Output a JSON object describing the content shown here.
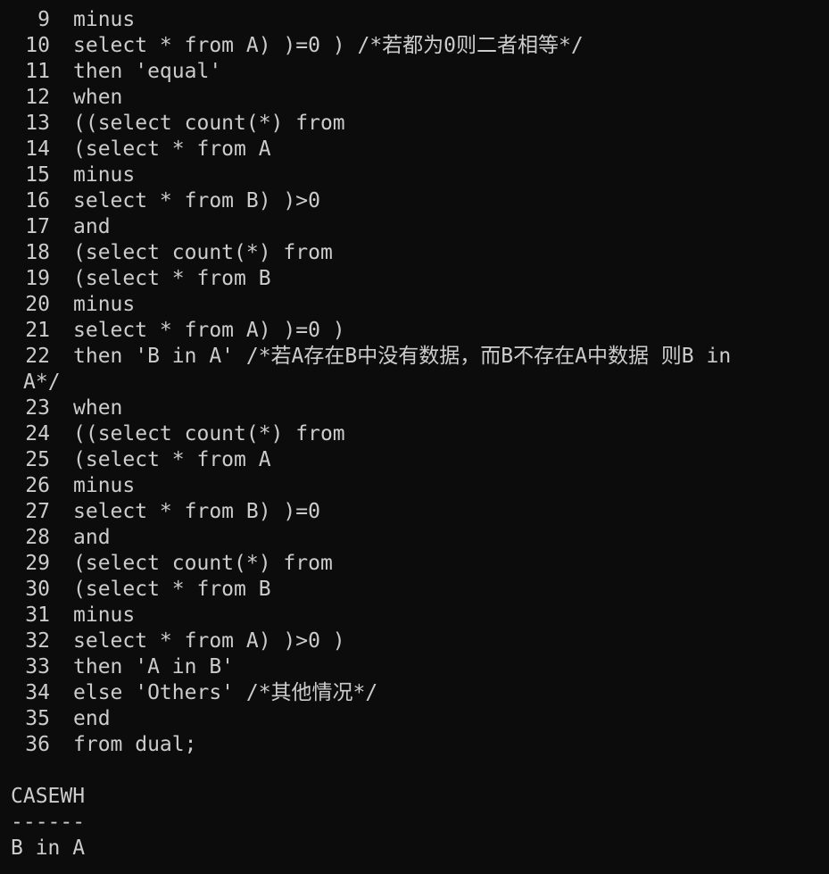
{
  "terminal": {
    "sql_lines": [
      {
        "num": "9",
        "text": "minus"
      },
      {
        "num": "10",
        "text": "select * from A) )=0 ) /*若都为0则二者相等*/"
      },
      {
        "num": "11",
        "text": "then 'equal'"
      },
      {
        "num": "12",
        "text": "when"
      },
      {
        "num": "13",
        "text": "((select count(*) from"
      },
      {
        "num": "14",
        "text": "(select * from A"
      },
      {
        "num": "15",
        "text": "minus"
      },
      {
        "num": "16",
        "text": "select * from B) )>0"
      },
      {
        "num": "17",
        "text": "and"
      },
      {
        "num": "18",
        "text": "(select count(*) from"
      },
      {
        "num": "19",
        "text": "(select * from B"
      },
      {
        "num": "20",
        "text": "minus"
      },
      {
        "num": "21",
        "text": "select * from A) )=0 )"
      },
      {
        "num": "22",
        "text": "then 'B in A' /*若A存在B中没有数据，而B不存在A中数据 则B in"
      },
      {
        "num": "",
        "text": "A*/"
      },
      {
        "num": "23",
        "text": "when"
      },
      {
        "num": "24",
        "text": "((select count(*) from"
      },
      {
        "num": "25",
        "text": "(select * from A"
      },
      {
        "num": "26",
        "text": "minus"
      },
      {
        "num": "27",
        "text": "select * from B) )=0"
      },
      {
        "num": "28",
        "text": "and"
      },
      {
        "num": "29",
        "text": "(select count(*) from"
      },
      {
        "num": "30",
        "text": "(select * from B"
      },
      {
        "num": "31",
        "text": "minus"
      },
      {
        "num": "32",
        "text": "select * from A) )>0 )"
      },
      {
        "num": "33",
        "text": "then 'A in B'"
      },
      {
        "num": "34",
        "text": "else 'Others' /*其他情况*/"
      },
      {
        "num": "35",
        "text": "end"
      },
      {
        "num": "36",
        "text": "from dual;"
      }
    ],
    "result": {
      "column_header": "CASEWH",
      "separator": "------",
      "value": "B in A"
    }
  }
}
